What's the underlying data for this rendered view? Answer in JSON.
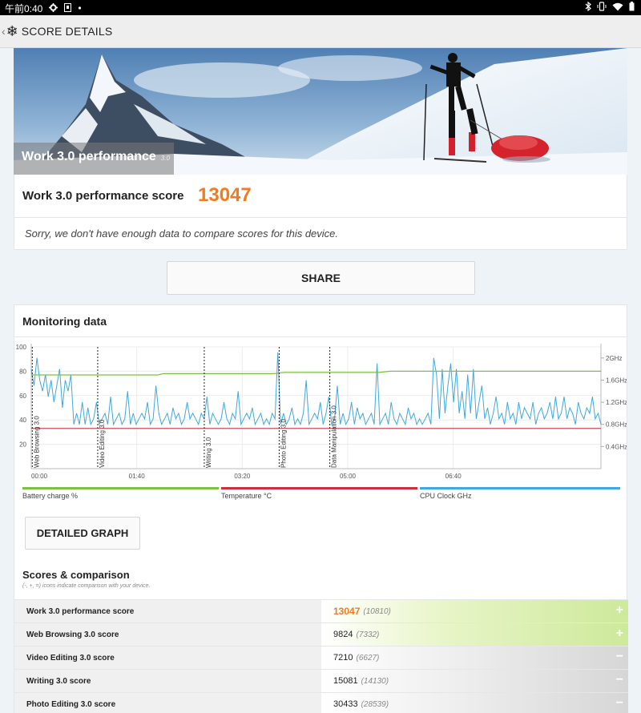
{
  "status_bar": {
    "time": "午前0:40",
    "icons_left": [
      "gear-icon",
      "sim-icon",
      "dot-icon"
    ],
    "icons_right": [
      "bluetooth-icon",
      "vibrate-icon",
      "wifi-icon",
      "battery-icon"
    ]
  },
  "app_bar": {
    "back_glyph": "‹",
    "logo_glyph": "❄",
    "title": "SCORE DETAILS"
  },
  "hero": {
    "title": "Work 3.0 performance",
    "version": "3.0"
  },
  "score": {
    "label": "Work 3.0 performance score",
    "value": "13047",
    "value_color": "#f47a20"
  },
  "compare_note": "Sorry, we don't have enough data to compare scores for this device.",
  "share_label": "SHARE",
  "monitoring": {
    "title": "Monitoring data",
    "legend": [
      {
        "label": "Battery charge %",
        "color": "#7cc142"
      },
      {
        "label": "Temperature °C",
        "color": "#c8323a"
      },
      {
        "label": "CPU Clock GHz",
        "color": "#3fa9dc"
      }
    ]
  },
  "chart_data": {
    "type": "line",
    "x_ticks": [
      "00:00",
      "01:40",
      "03:20",
      "05:00",
      "06:40"
    ],
    "x_range_seconds": [
      0,
      540
    ],
    "y_left_ticks": [
      "100",
      "80",
      "60",
      "40",
      "20"
    ],
    "y_left_range": [
      0,
      100
    ],
    "y_right_ticks": [
      "2GHz",
      "1.6GHz",
      "1.2GHz",
      "0.8GHz",
      "0.4GHz"
    ],
    "y_right_range_ghz": [
      0,
      2.2
    ],
    "grid": true,
    "markers": [
      {
        "label": "Web Browsing 3.0",
        "t": 1
      },
      {
        "label": "Video Editing 3.0",
        "t": 63
      },
      {
        "label": "Writing 3.0",
        "t": 164
      },
      {
        "label": "Photo Editing 3.0",
        "t": 235
      },
      {
        "label": "Data Manipulation 3.0",
        "t": 283
      }
    ],
    "series": [
      {
        "name": "Battery charge %",
        "axis": "left",
        "points": [
          [
            0,
            77
          ],
          [
            120,
            77
          ],
          [
            125,
            78
          ],
          [
            230,
            78
          ],
          [
            240,
            79
          ],
          [
            330,
            79
          ],
          [
            340,
            80
          ],
          [
            540,
            80
          ]
        ]
      },
      {
        "name": "Temperature °C",
        "axis": "left",
        "points": [
          [
            0,
            33
          ],
          [
            540,
            33
          ]
        ]
      },
      {
        "name": "CPU Clock GHz",
        "axis": "right",
        "values": [
          1.8,
          1.5,
          2.0,
          1.6,
          1.4,
          1.7,
          1.3,
          1.6,
          1.2,
          1.5,
          1.8,
          1.1,
          1.6,
          1.4,
          1.7,
          0.8,
          1.0,
          0.8,
          1.2,
          0.8,
          1.1,
          0.8,
          0.9,
          1.2,
          0.8,
          0.9,
          1.0,
          0.8,
          1.3,
          0.8,
          0.9,
          1.0,
          0.8,
          0.9,
          1.4,
          0.8,
          1.0,
          0.8,
          0.9,
          1.0,
          0.9,
          1.2,
          0.8,
          0.9,
          1.5,
          1.0,
          0.8,
          0.9,
          1.0,
          0.8,
          1.1,
          0.9,
          1.0,
          0.8,
          0.9,
          1.2,
          0.9,
          1.0,
          0.9,
          0.8,
          1.0,
          0.9,
          1.3,
          0.8,
          1.0,
          0.9,
          0.8,
          0.9,
          1.2,
          0.9,
          0.8,
          1.0,
          0.9,
          1.4,
          0.8,
          0.9,
          1.0,
          0.9,
          1.1,
          0.8,
          0.9,
          1.0,
          0.8,
          0.9,
          0.8,
          1.0,
          0.9,
          2.1,
          0.8,
          1.0,
          0.8,
          0.9,
          1.1,
          0.8,
          0.9,
          0.8,
          1.0,
          1.6,
          0.8,
          0.9,
          1.0,
          0.9,
          1.2,
          0.8,
          1.0,
          1.3,
          0.8,
          0.9,
          1.5,
          0.8,
          1.0,
          0.8,
          0.9,
          1.2,
          0.8,
          1.1,
          0.9,
          1.0,
          0.8,
          0.9,
          1.0,
          0.8,
          1.9,
          0.8,
          0.9,
          1.0,
          0.8,
          1.2,
          0.9,
          0.8,
          1.0,
          0.9,
          0.8,
          1.1,
          0.9,
          1.0,
          0.8,
          0.9,
          0.8,
          0.9,
          1.0,
          0.8,
          2.0,
          1.7,
          0.9,
          1.8,
          1.0,
          1.5,
          1.9,
          1.2,
          1.8,
          1.0,
          1.4,
          0.9,
          1.7,
          1.0,
          1.8,
          0.9,
          1.2,
          1.5,
          0.9,
          1.1,
          0.8,
          1.0,
          1.3,
          0.9,
          1.0,
          0.8,
          1.2,
          0.9,
          1.0,
          0.8,
          1.2,
          0.9,
          1.1,
          1.0,
          0.9,
          1.2,
          0.8,
          1.0,
          1.1,
          0.9,
          1.0,
          1.2,
          0.9,
          1.3,
          0.9,
          1.0,
          1.3,
          0.9,
          1.1,
          1.0,
          0.8,
          1.2,
          1.0,
          0.9,
          1.1,
          1.0,
          1.3,
          0.9,
          1.0,
          0.8
        ]
      }
    ]
  },
  "detailed_graph_label": "DETAILED GRAPH",
  "scores": {
    "title": "Scores & comparison",
    "note": "(-, +, =) icons indicate comparison with your device.",
    "rows": [
      {
        "name": "Work 3.0 performance score",
        "value": "13047",
        "ref": "(10810)",
        "sign": "+",
        "accent": true
      },
      {
        "name": "Web Browsing 3.0 score",
        "value": "9824",
        "ref": "(7332)",
        "sign": "+",
        "accent": false
      },
      {
        "name": "Video Editing 3.0 score",
        "value": "7210",
        "ref": "(6627)",
        "sign": "−",
        "accent": false
      },
      {
        "name": "Writing 3.0 score",
        "value": "15081",
        "ref": "(14130)",
        "sign": "−",
        "accent": false
      },
      {
        "name": "Photo Editing 3.0 score",
        "value": "30433",
        "ref": "(28539)",
        "sign": "−",
        "accent": false
      }
    ]
  }
}
